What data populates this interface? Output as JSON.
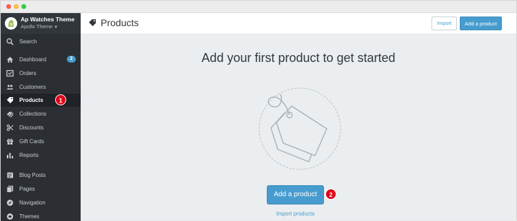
{
  "store": {
    "name": "Ap Watches Theme",
    "subtitle": "Apollo Theme"
  },
  "sidebar": {
    "items": [
      {
        "label": "Search",
        "icon": "search-icon"
      },
      {
        "label": "Dashboard",
        "icon": "home-icon",
        "badge": "2"
      },
      {
        "label": "Orders",
        "icon": "orders-icon"
      },
      {
        "label": "Customers",
        "icon": "customers-icon"
      },
      {
        "label": "Products",
        "icon": "tag-icon",
        "active": true
      },
      {
        "label": "Collections",
        "icon": "collections-icon"
      },
      {
        "label": "Discounts",
        "icon": "discounts-icon"
      },
      {
        "label": "Gift Cards",
        "icon": "gift-icon"
      },
      {
        "label": "Reports",
        "icon": "reports-icon"
      },
      {
        "label": "Blog Posts",
        "icon": "blog-icon"
      },
      {
        "label": "Pages",
        "icon": "pages-icon"
      },
      {
        "label": "Navigation",
        "icon": "navigation-icon"
      },
      {
        "label": "Themes",
        "icon": "themes-icon"
      }
    ]
  },
  "steps": {
    "one": "1",
    "two": "2"
  },
  "header": {
    "title": "Products",
    "import_label": "Import",
    "add_label": "Add a product"
  },
  "empty_state": {
    "title": "Add your first product to get started",
    "add_label": "Add a product",
    "import_link": "Import products"
  },
  "colors": {
    "sidebar": "#2b2f33",
    "accent": "#479ccf",
    "step_marker": "#e2001a"
  }
}
